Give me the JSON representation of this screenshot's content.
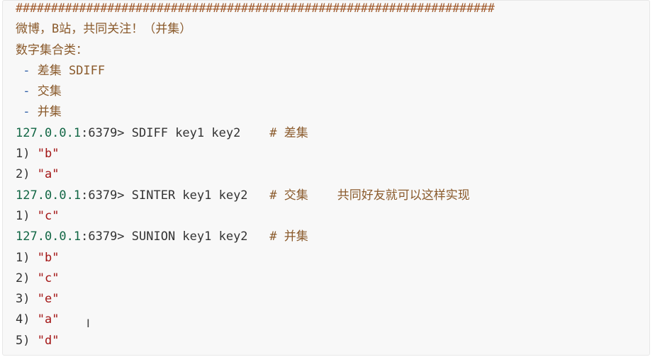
{
  "code": {
    "hash_line": "####################################################################",
    "comment_weibo": "微博，B站，共同关注！（并集）",
    "comment_types": "数字集合类：",
    "bullets": [
      {
        "dash": " - ",
        "text": "差集 SDIFF"
      },
      {
        "dash": " - ",
        "text": "交集"
      },
      {
        "dash": " - ",
        "text": "并集"
      }
    ],
    "commands": [
      {
        "prompt_ip": "127.0.0.1",
        "prompt_port": ":6379>",
        "command": " SDIFF key1 key2",
        "pad": "    ",
        "hash": "#",
        "comment": " 差集",
        "results": [
          {
            "index": "1) ",
            "value": "\"b\""
          },
          {
            "index": "2) ",
            "value": "\"a\""
          }
        ]
      },
      {
        "prompt_ip": "127.0.0.1",
        "prompt_port": ":6379>",
        "command": " SINTER key1 key2",
        "pad": "   ",
        "hash": "#",
        "comment": " 交集    共同好友就可以这样实现",
        "results": [
          {
            "index": "1) ",
            "value": "\"c\""
          }
        ]
      },
      {
        "prompt_ip": "127.0.0.1",
        "prompt_port": ":6379>",
        "command": " SUNION key1 key2",
        "pad": "   ",
        "hash": "#",
        "comment": " 并集",
        "results": [
          {
            "index": "1) ",
            "value": "\"b\""
          },
          {
            "index": "2) ",
            "value": "\"c\""
          },
          {
            "index": "3) ",
            "value": "\"e\""
          },
          {
            "index": "4) ",
            "value": "\"a\""
          },
          {
            "index": "5) ",
            "value": "\"d\""
          }
        ]
      }
    ]
  },
  "cursor": {
    "glyph": "I",
    "icon": "text-cursor-icon"
  }
}
